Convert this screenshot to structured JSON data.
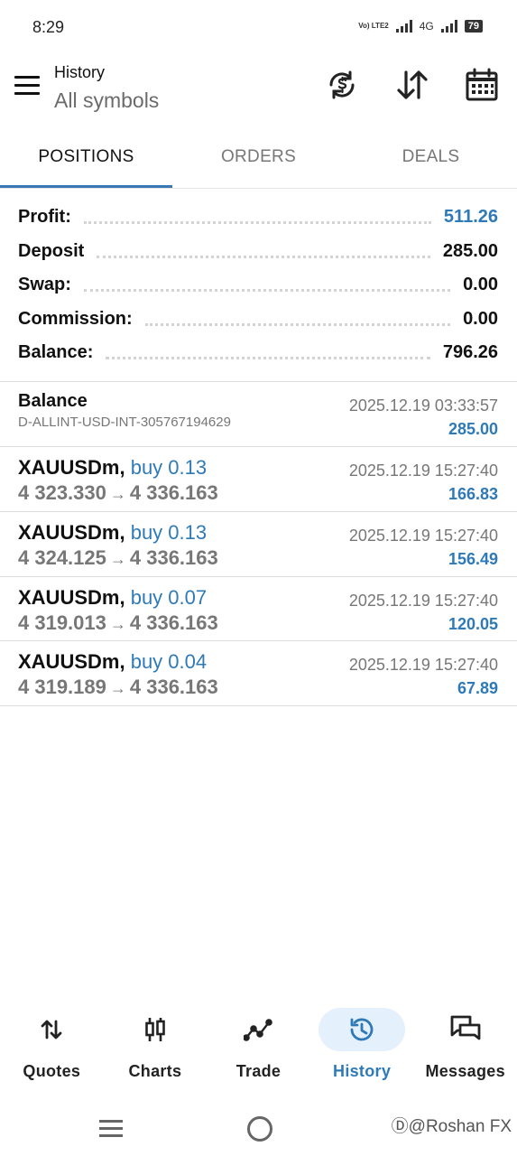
{
  "status_bar": {
    "time": "8:29",
    "network": "4G",
    "volte": "Vo) LTE2",
    "battery": "79"
  },
  "header": {
    "title": "History",
    "subtitle": "All symbols"
  },
  "tabs": [
    {
      "label": "POSITIONS",
      "active": true
    },
    {
      "label": "ORDERS",
      "active": false
    },
    {
      "label": "DEALS",
      "active": false
    }
  ],
  "summary": {
    "profit_label": "Profit:",
    "profit": "511.26",
    "deposit_label": "Deposit",
    "deposit": "285.00",
    "swap_label": "Swap:",
    "swap": "0.00",
    "commission_label": "Commission:",
    "commission": "0.00",
    "balance_label": "Balance:",
    "balance": "796.26"
  },
  "balance_entry": {
    "title": "Balance",
    "account": "D-ALLINT-USD-INT-305767194629",
    "datetime": "2025.12.19 03:33:57",
    "amount": "285.00"
  },
  "deals": [
    {
      "symbol": "XAUUSDm,",
      "side": "buy 0.13",
      "open": "4 323.330",
      "arrow": "→",
      "close": "4 336.163",
      "datetime": "2025.12.19 15:27:40",
      "profit": "166.83"
    },
    {
      "symbol": "XAUUSDm,",
      "side": "buy 0.13",
      "open": "4 324.125",
      "arrow": "→",
      "close": "4 336.163",
      "datetime": "2025.12.19 15:27:40",
      "profit": "156.49"
    },
    {
      "symbol": "XAUUSDm,",
      "side": "buy 0.07",
      "open": "4 319.013",
      "arrow": "→",
      "close": "4 336.163",
      "datetime": "2025.12.19 15:27:40",
      "profit": "120.05"
    },
    {
      "symbol": "XAUUSDm,",
      "side": "buy 0.04",
      "open": "4 319.189",
      "arrow": "→",
      "close": "4 336.163",
      "datetime": "2025.12.19 15:27:40",
      "profit": "67.89"
    }
  ],
  "bottom_nav": [
    {
      "label": "Quotes",
      "icon": "quotes-icon",
      "active": false
    },
    {
      "label": "Charts",
      "icon": "charts-icon",
      "active": false
    },
    {
      "label": "Trade",
      "icon": "trade-icon",
      "active": false
    },
    {
      "label": "History",
      "icon": "history-icon",
      "active": true
    },
    {
      "label": "Messages",
      "icon": "messages-icon",
      "active": false
    }
  ],
  "watermark": "Ⓓ@Roshan FX",
  "colors": {
    "accent": "#2e7ab8",
    "tab_indicator": "#3a78b5",
    "active_nav_bg": "#e4f0fb"
  }
}
